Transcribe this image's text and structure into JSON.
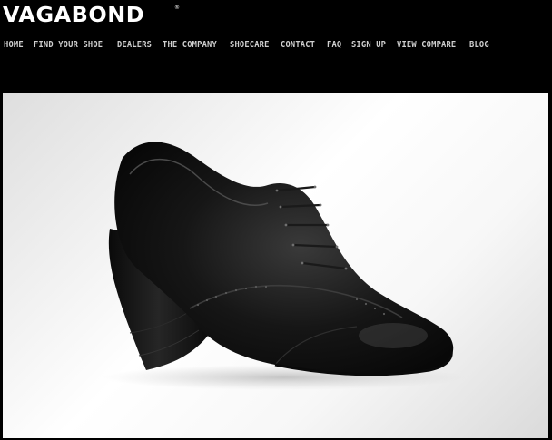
{
  "brand": {
    "name": "VAGABOND",
    "registered_mark": "®"
  },
  "nav": {
    "items": [
      {
        "label": "HOME"
      },
      {
        "label": "FIND YOUR SHOE"
      },
      {
        "label": "DEALERS"
      },
      {
        "label": "THE COMPANY"
      },
      {
        "label": "SHOECARE"
      },
      {
        "label": "CONTACT"
      },
      {
        "label": "FAQ"
      },
      {
        "label": "SIGN UP"
      },
      {
        "label": "VIEW COMPARE"
      },
      {
        "label": "BLOG"
      }
    ]
  },
  "hero": {
    "image": "black-leather-wedge-oxford-shoe",
    "background": "#f2f2f2"
  },
  "colors": {
    "page_bg": "#000000",
    "nav_text": "#cfcfcf",
    "logo": "#ffffff"
  }
}
